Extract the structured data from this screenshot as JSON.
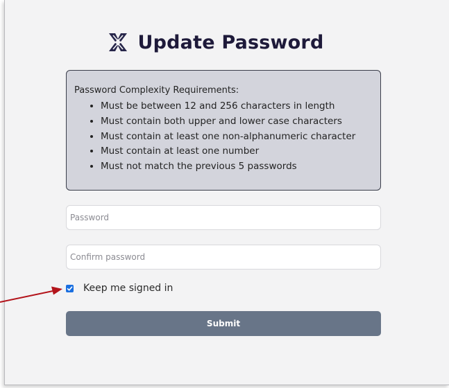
{
  "form": {
    "title": "Update Password",
    "logo_icon": "x-cross-logo-icon",
    "requirements": {
      "heading": "Password Complexity Requirements:",
      "items": [
        "Must be between 12 and 256 characters in length",
        "Must contain both upper and lower case characters",
        "Must contain at least one non-alphanumeric character",
        "Must contain at least one number",
        "Must not match the previous 5 passwords"
      ]
    },
    "password": {
      "placeholder": "Password",
      "value": ""
    },
    "confirm_password": {
      "placeholder": "Confirm password",
      "value": ""
    },
    "keep_signed_in": {
      "label": "Keep me signed in",
      "checked": true
    },
    "submit_label": "Submit"
  },
  "annotation": {
    "arrow_color": "#b3141b",
    "target": "keep-signed-in-checkbox"
  },
  "colors": {
    "title": "#1e1a3a",
    "requirements_bg": "#d3d4dc",
    "requirements_border": "#3a3d4a",
    "checkbox": "#1a6fe0",
    "submit_bg": "#687588",
    "panel_bg": "#f3f3f4"
  }
}
